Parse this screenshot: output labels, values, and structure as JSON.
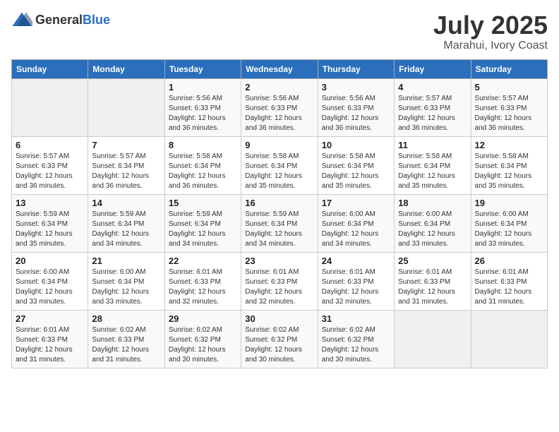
{
  "logo": {
    "general": "General",
    "blue": "Blue"
  },
  "header": {
    "month": "July 2025",
    "location": "Marahui, Ivory Coast"
  },
  "weekdays": [
    "Sunday",
    "Monday",
    "Tuesday",
    "Wednesday",
    "Thursday",
    "Friday",
    "Saturday"
  ],
  "weeks": [
    [
      {
        "day": "",
        "sunrise": "",
        "sunset": "",
        "daylight": ""
      },
      {
        "day": "",
        "sunrise": "",
        "sunset": "",
        "daylight": ""
      },
      {
        "day": "1",
        "sunrise": "Sunrise: 5:56 AM",
        "sunset": "Sunset: 6:33 PM",
        "daylight": "Daylight: 12 hours and 36 minutes."
      },
      {
        "day": "2",
        "sunrise": "Sunrise: 5:56 AM",
        "sunset": "Sunset: 6:33 PM",
        "daylight": "Daylight: 12 hours and 36 minutes."
      },
      {
        "day": "3",
        "sunrise": "Sunrise: 5:56 AM",
        "sunset": "Sunset: 6:33 PM",
        "daylight": "Daylight: 12 hours and 36 minutes."
      },
      {
        "day": "4",
        "sunrise": "Sunrise: 5:57 AM",
        "sunset": "Sunset: 6:33 PM",
        "daylight": "Daylight: 12 hours and 36 minutes."
      },
      {
        "day": "5",
        "sunrise": "Sunrise: 5:57 AM",
        "sunset": "Sunset: 6:33 PM",
        "daylight": "Daylight: 12 hours and 36 minutes."
      }
    ],
    [
      {
        "day": "6",
        "sunrise": "Sunrise: 5:57 AM",
        "sunset": "Sunset: 6:33 PM",
        "daylight": "Daylight: 12 hours and 36 minutes."
      },
      {
        "day": "7",
        "sunrise": "Sunrise: 5:57 AM",
        "sunset": "Sunset: 6:34 PM",
        "daylight": "Daylight: 12 hours and 36 minutes."
      },
      {
        "day": "8",
        "sunrise": "Sunrise: 5:58 AM",
        "sunset": "Sunset: 6:34 PM",
        "daylight": "Daylight: 12 hours and 36 minutes."
      },
      {
        "day": "9",
        "sunrise": "Sunrise: 5:58 AM",
        "sunset": "Sunset: 6:34 PM",
        "daylight": "Daylight: 12 hours and 35 minutes."
      },
      {
        "day": "10",
        "sunrise": "Sunrise: 5:58 AM",
        "sunset": "Sunset: 6:34 PM",
        "daylight": "Daylight: 12 hours and 35 minutes."
      },
      {
        "day": "11",
        "sunrise": "Sunrise: 5:58 AM",
        "sunset": "Sunset: 6:34 PM",
        "daylight": "Daylight: 12 hours and 35 minutes."
      },
      {
        "day": "12",
        "sunrise": "Sunrise: 5:58 AM",
        "sunset": "Sunset: 6:34 PM",
        "daylight": "Daylight: 12 hours and 35 minutes."
      }
    ],
    [
      {
        "day": "13",
        "sunrise": "Sunrise: 5:59 AM",
        "sunset": "Sunset: 6:34 PM",
        "daylight": "Daylight: 12 hours and 35 minutes."
      },
      {
        "day": "14",
        "sunrise": "Sunrise: 5:59 AM",
        "sunset": "Sunset: 6:34 PM",
        "daylight": "Daylight: 12 hours and 34 minutes."
      },
      {
        "day": "15",
        "sunrise": "Sunrise: 5:59 AM",
        "sunset": "Sunset: 6:34 PM",
        "daylight": "Daylight: 12 hours and 34 minutes."
      },
      {
        "day": "16",
        "sunrise": "Sunrise: 5:59 AM",
        "sunset": "Sunset: 6:34 PM",
        "daylight": "Daylight: 12 hours and 34 minutes."
      },
      {
        "day": "17",
        "sunrise": "Sunrise: 6:00 AM",
        "sunset": "Sunset: 6:34 PM",
        "daylight": "Daylight: 12 hours and 34 minutes."
      },
      {
        "day": "18",
        "sunrise": "Sunrise: 6:00 AM",
        "sunset": "Sunset: 6:34 PM",
        "daylight": "Daylight: 12 hours and 33 minutes."
      },
      {
        "day": "19",
        "sunrise": "Sunrise: 6:00 AM",
        "sunset": "Sunset: 6:34 PM",
        "daylight": "Daylight: 12 hours and 33 minutes."
      }
    ],
    [
      {
        "day": "20",
        "sunrise": "Sunrise: 6:00 AM",
        "sunset": "Sunset: 6:34 PM",
        "daylight": "Daylight: 12 hours and 33 minutes."
      },
      {
        "day": "21",
        "sunrise": "Sunrise: 6:00 AM",
        "sunset": "Sunset: 6:34 PM",
        "daylight": "Daylight: 12 hours and 33 minutes."
      },
      {
        "day": "22",
        "sunrise": "Sunrise: 6:01 AM",
        "sunset": "Sunset: 6:33 PM",
        "daylight": "Daylight: 12 hours and 32 minutes."
      },
      {
        "day": "23",
        "sunrise": "Sunrise: 6:01 AM",
        "sunset": "Sunset: 6:33 PM",
        "daylight": "Daylight: 12 hours and 32 minutes."
      },
      {
        "day": "24",
        "sunrise": "Sunrise: 6:01 AM",
        "sunset": "Sunset: 6:33 PM",
        "daylight": "Daylight: 12 hours and 32 minutes."
      },
      {
        "day": "25",
        "sunrise": "Sunrise: 6:01 AM",
        "sunset": "Sunset: 6:33 PM",
        "daylight": "Daylight: 12 hours and 31 minutes."
      },
      {
        "day": "26",
        "sunrise": "Sunrise: 6:01 AM",
        "sunset": "Sunset: 6:33 PM",
        "daylight": "Daylight: 12 hours and 31 minutes."
      }
    ],
    [
      {
        "day": "27",
        "sunrise": "Sunrise: 6:01 AM",
        "sunset": "Sunset: 6:33 PM",
        "daylight": "Daylight: 12 hours and 31 minutes."
      },
      {
        "day": "28",
        "sunrise": "Sunrise: 6:02 AM",
        "sunset": "Sunset: 6:33 PM",
        "daylight": "Daylight: 12 hours and 31 minutes."
      },
      {
        "day": "29",
        "sunrise": "Sunrise: 6:02 AM",
        "sunset": "Sunset: 6:32 PM",
        "daylight": "Daylight: 12 hours and 30 minutes."
      },
      {
        "day": "30",
        "sunrise": "Sunrise: 6:02 AM",
        "sunset": "Sunset: 6:32 PM",
        "daylight": "Daylight: 12 hours and 30 minutes."
      },
      {
        "day": "31",
        "sunrise": "Sunrise: 6:02 AM",
        "sunset": "Sunset: 6:32 PM",
        "daylight": "Daylight: 12 hours and 30 minutes."
      },
      {
        "day": "",
        "sunrise": "",
        "sunset": "",
        "daylight": ""
      },
      {
        "day": "",
        "sunrise": "",
        "sunset": "",
        "daylight": ""
      }
    ]
  ]
}
